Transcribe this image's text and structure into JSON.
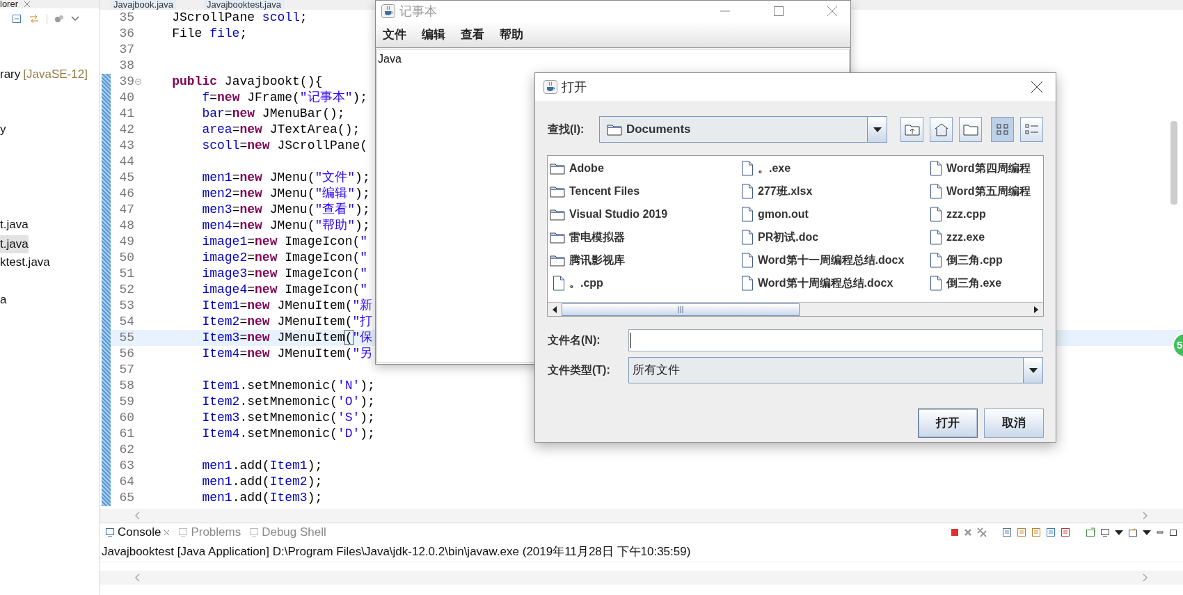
{
  "sidebar": {
    "title": "lorer",
    "items": [
      {
        "text": "rary",
        "decoration": "[JavaSE-12]",
        "selected": false
      },
      {
        "text": "y",
        "selected": false
      },
      {
        "text": "t.java",
        "selected": false
      },
      {
        "text": "t.java",
        "selected": true
      },
      {
        "text": "ktest.java",
        "selected": false
      },
      {
        "text": "a",
        "selected": false
      }
    ]
  },
  "editor": {
    "tabs": [
      "Javajbook.java",
      "Javajbooktest.java"
    ],
    "lines": [
      {
        "number": "35",
        "changed": false,
        "fold": false,
        "current": false,
        "tokens": [
          {
            "text": "    JScrollPane ",
            "kind": "plain"
          },
          {
            "text": "scoll",
            "kind": "field"
          },
          {
            "text": ";",
            "kind": "plain"
          }
        ]
      },
      {
        "number": "36",
        "changed": false,
        "fold": false,
        "current": false,
        "tokens": [
          {
            "text": "    File ",
            "kind": "plain"
          },
          {
            "text": "file",
            "kind": "field"
          },
          {
            "text": ";",
            "kind": "plain"
          }
        ]
      },
      {
        "number": "37",
        "changed": false,
        "fold": false,
        "current": false
      },
      {
        "number": "38",
        "changed": false,
        "fold": false,
        "current": false
      },
      {
        "number": "39",
        "changed": true,
        "fold": true,
        "current": false,
        "tokens": [
          {
            "text": "    public",
            "kind": "keyword"
          },
          {
            "text": " Javajbookt(){",
            "kind": "plain"
          }
        ]
      },
      {
        "number": "40",
        "changed": true,
        "fold": false,
        "current": false,
        "tokens": [
          {
            "text": "        f",
            "kind": "field"
          },
          {
            "text": "=",
            "kind": "plain"
          },
          {
            "text": "new",
            "kind": "keyword"
          },
          {
            "text": " JFrame(",
            "kind": "plain"
          },
          {
            "text": "\"记事本\"",
            "kind": "string"
          },
          {
            "text": ");",
            "kind": "plain"
          }
        ]
      },
      {
        "number": "41",
        "changed": true,
        "fold": false,
        "current": false,
        "tokens": [
          {
            "text": "        bar",
            "kind": "field"
          },
          {
            "text": "=",
            "kind": "plain"
          },
          {
            "text": "new",
            "kind": "keyword"
          },
          {
            "text": " JMenuBar();",
            "kind": "plain"
          }
        ]
      },
      {
        "number": "42",
        "changed": true,
        "fold": false,
        "current": false,
        "tokens": [
          {
            "text": "        area",
            "kind": "field"
          },
          {
            "text": "=",
            "kind": "plain"
          },
          {
            "text": "new",
            "kind": "keyword"
          },
          {
            "text": " JTextArea();",
            "kind": "plain"
          }
        ]
      },
      {
        "number": "43",
        "changed": true,
        "fold": false,
        "current": false,
        "tokens": [
          {
            "text": "        scoll",
            "kind": "field"
          },
          {
            "text": "=",
            "kind": "plain"
          },
          {
            "text": "new",
            "kind": "keyword"
          },
          {
            "text": " JScrollPane(",
            "kind": "plain"
          }
        ]
      },
      {
        "number": "44",
        "changed": true,
        "fold": false,
        "current": false
      },
      {
        "number": "45",
        "changed": true,
        "fold": false,
        "current": false,
        "tokens": [
          {
            "text": "        men1",
            "kind": "field"
          },
          {
            "text": "=",
            "kind": "plain"
          },
          {
            "text": "new",
            "kind": "keyword"
          },
          {
            "text": " JMenu(",
            "kind": "plain"
          },
          {
            "text": "\"文件\"",
            "kind": "string"
          },
          {
            "text": ");",
            "kind": "plain"
          }
        ]
      },
      {
        "number": "46",
        "changed": true,
        "fold": false,
        "current": false,
        "tokens": [
          {
            "text": "        men2",
            "kind": "field"
          },
          {
            "text": "=",
            "kind": "plain"
          },
          {
            "text": "new",
            "kind": "keyword"
          },
          {
            "text": " JMenu(",
            "kind": "plain"
          },
          {
            "text": "\"编辑\"",
            "kind": "string"
          },
          {
            "text": ");",
            "kind": "plain"
          }
        ]
      },
      {
        "number": "47",
        "changed": true,
        "fold": false,
        "current": false,
        "tokens": [
          {
            "text": "        men3",
            "kind": "field"
          },
          {
            "text": "=",
            "kind": "plain"
          },
          {
            "text": "new",
            "kind": "keyword"
          },
          {
            "text": " JMenu(",
            "kind": "plain"
          },
          {
            "text": "\"查看\"",
            "kind": "string"
          },
          {
            "text": ");",
            "kind": "plain"
          }
        ]
      },
      {
        "number": "48",
        "changed": true,
        "fold": false,
        "current": false,
        "tokens": [
          {
            "text": "        men4",
            "kind": "field"
          },
          {
            "text": "=",
            "kind": "plain"
          },
          {
            "text": "new",
            "kind": "keyword"
          },
          {
            "text": " JMenu(",
            "kind": "plain"
          },
          {
            "text": "\"帮助\"",
            "kind": "string"
          },
          {
            "text": ");",
            "kind": "plain"
          }
        ]
      },
      {
        "number": "49",
        "changed": true,
        "fold": false,
        "current": false,
        "tokens": [
          {
            "text": "        image1",
            "kind": "field"
          },
          {
            "text": "=",
            "kind": "plain"
          },
          {
            "text": "new",
            "kind": "keyword"
          },
          {
            "text": " ImageIcon(",
            "kind": "plain"
          },
          {
            "text": "\"",
            "kind": "string"
          }
        ]
      },
      {
        "number": "50",
        "changed": true,
        "fold": false,
        "current": false,
        "tokens": [
          {
            "text": "        image2",
            "kind": "field"
          },
          {
            "text": "=",
            "kind": "plain"
          },
          {
            "text": "new",
            "kind": "keyword"
          },
          {
            "text": " ImageIcon(",
            "kind": "plain"
          },
          {
            "text": "\"",
            "kind": "string"
          }
        ]
      },
      {
        "number": "51",
        "changed": true,
        "fold": false,
        "current": false,
        "tokens": [
          {
            "text": "        image3",
            "kind": "field"
          },
          {
            "text": "=",
            "kind": "plain"
          },
          {
            "text": "new",
            "kind": "keyword"
          },
          {
            "text": " ImageIcon(",
            "kind": "plain"
          },
          {
            "text": "\"",
            "kind": "string"
          }
        ]
      },
      {
        "number": "52",
        "changed": true,
        "fold": false,
        "current": false,
        "tokens": [
          {
            "text": "        image4",
            "kind": "field"
          },
          {
            "text": "=",
            "kind": "plain"
          },
          {
            "text": "new",
            "kind": "keyword"
          },
          {
            "text": " ImageIcon(",
            "kind": "plain"
          },
          {
            "text": "\"",
            "kind": "string"
          }
        ]
      },
      {
        "number": "53",
        "changed": true,
        "fold": false,
        "current": false,
        "tokens": [
          {
            "text": "        Item1",
            "kind": "field"
          },
          {
            "text": "=",
            "kind": "plain"
          },
          {
            "text": "new",
            "kind": "keyword"
          },
          {
            "text": " JMenuItem(",
            "kind": "plain"
          },
          {
            "text": "\"新",
            "kind": "string"
          }
        ]
      },
      {
        "number": "54",
        "changed": true,
        "fold": false,
        "current": false,
        "tokens": [
          {
            "text": "        Item2",
            "kind": "field"
          },
          {
            "text": "=",
            "kind": "plain"
          },
          {
            "text": "new",
            "kind": "keyword"
          },
          {
            "text": " JMenuItem(",
            "kind": "plain"
          },
          {
            "text": "\"打",
            "kind": "string"
          }
        ]
      },
      {
        "number": "55",
        "changed": true,
        "fold": false,
        "current": true,
        "tokens": [
          {
            "text": "        Item3",
            "kind": "field"
          },
          {
            "text": "=",
            "kind": "plain"
          },
          {
            "text": "new",
            "kind": "keyword"
          },
          {
            "text": " JMenuItem",
            "kind": "plain"
          },
          {
            "text": "(",
            "kind": "match"
          },
          {
            "text": "\"保",
            "kind": "string"
          }
        ]
      },
      {
        "number": "56",
        "changed": true,
        "fold": false,
        "current": false,
        "tokens": [
          {
            "text": "        Item4",
            "kind": "field"
          },
          {
            "text": "=",
            "kind": "plain"
          },
          {
            "text": "new",
            "kind": "keyword"
          },
          {
            "text": " JMenuItem(",
            "kind": "plain"
          },
          {
            "text": "\"另",
            "kind": "string"
          }
        ]
      },
      {
        "number": "57",
        "changed": true,
        "fold": false,
        "current": false
      },
      {
        "number": "58",
        "changed": true,
        "fold": false,
        "current": false,
        "tokens": [
          {
            "text": "        Item1",
            "kind": "field"
          },
          {
            "text": ".setMnemonic(",
            "kind": "plain"
          },
          {
            "text": "'N'",
            "kind": "string"
          },
          {
            "text": ");",
            "kind": "plain"
          }
        ]
      },
      {
        "number": "59",
        "changed": true,
        "fold": false,
        "current": false,
        "tokens": [
          {
            "text": "        Item2",
            "kind": "field"
          },
          {
            "text": ".setMnemonic(",
            "kind": "plain"
          },
          {
            "text": "'O'",
            "kind": "string"
          },
          {
            "text": ");",
            "kind": "plain"
          }
        ]
      },
      {
        "number": "60",
        "changed": true,
        "fold": false,
        "current": false,
        "tokens": [
          {
            "text": "        Item3",
            "kind": "field"
          },
          {
            "text": ".setMnemonic(",
            "kind": "plain"
          },
          {
            "text": "'S'",
            "kind": "string"
          },
          {
            "text": ");",
            "kind": "plain"
          }
        ]
      },
      {
        "number": "61",
        "changed": true,
        "fold": false,
        "current": false,
        "tokens": [
          {
            "text": "        Item4",
            "kind": "field"
          },
          {
            "text": ".setMnemonic(",
            "kind": "plain"
          },
          {
            "text": "'D'",
            "kind": "string"
          },
          {
            "text": ");",
            "kind": "plain"
          }
        ]
      },
      {
        "number": "62",
        "changed": true,
        "fold": false,
        "current": false
      },
      {
        "number": "63",
        "changed": true,
        "fold": false,
        "current": false,
        "tokens": [
          {
            "text": "        men1",
            "kind": "field"
          },
          {
            "text": ".add(",
            "kind": "plain"
          },
          {
            "text": "Item1",
            "kind": "field"
          },
          {
            "text": ");",
            "kind": "plain"
          }
        ]
      },
      {
        "number": "64",
        "changed": true,
        "fold": false,
        "current": false,
        "tokens": [
          {
            "text": "        men1",
            "kind": "field"
          },
          {
            "text": ".add(",
            "kind": "plain"
          },
          {
            "text": "Item2",
            "kind": "field"
          },
          {
            "text": ");",
            "kind": "plain"
          }
        ]
      },
      {
        "number": "65",
        "changed": true,
        "fold": false,
        "current": false,
        "tokens": [
          {
            "text": "        men1",
            "kind": "field"
          },
          {
            "text": ".add(",
            "kind": "plain"
          },
          {
            "text": "Item3",
            "kind": "field"
          },
          {
            "text": ");",
            "kind": "plain"
          }
        ]
      }
    ]
  },
  "console": {
    "tabs": [
      {
        "label": "Console",
        "selected": true
      },
      {
        "label": "Problems",
        "selected": false
      },
      {
        "label": "Debug Shell",
        "selected": false
      }
    ],
    "text": "Javajbooktest [Java Application] D:\\Program Files\\Java\\jdk-12.0.2\\bin\\javaw.exe (2019年11月28日 下午10:35:59)"
  },
  "badge": "5",
  "notepad": {
    "title": "记事本",
    "menus": [
      "文件",
      "编辑",
      "查看",
      "帮助"
    ],
    "content": "Java"
  },
  "dialog": {
    "title": "打开",
    "look_in": {
      "label": "查找(I):",
      "value": "Documents"
    },
    "tool_buttons": [
      {
        "kind": "up",
        "selected": false
      },
      {
        "kind": "home",
        "selected": false
      },
      {
        "kind": "new-folder",
        "selected": false
      },
      {
        "kind": "list",
        "selected": true
      },
      {
        "kind": "details",
        "selected": false
      }
    ],
    "files": [
      {
        "name": "Adobe",
        "kind": "folder"
      },
      {
        "name": "Tencent Files",
        "kind": "folder"
      },
      {
        "name": "Visual Studio 2019",
        "kind": "folder"
      },
      {
        "name": "雷电模拟器",
        "kind": "folder"
      },
      {
        "name": "腾讯影视库",
        "kind": "folder"
      },
      {
        "name": "。.cpp",
        "kind": "file"
      },
      {
        "name": "。.exe",
        "kind": "file"
      },
      {
        "name": "277班.xlsx",
        "kind": "file"
      },
      {
        "name": "gmon.out",
        "kind": "file"
      },
      {
        "name": "PR初试.doc",
        "kind": "file"
      },
      {
        "name": "Word第十一周编程总结.docx",
        "kind": "file"
      },
      {
        "name": "Word第十周编程总结.docx",
        "kind": "file"
      },
      {
        "name": "Word第四周编程",
        "kind": "file"
      },
      {
        "name": "Word第五周编程",
        "kind": "file"
      },
      {
        "name": "zzz.cpp",
        "kind": "file"
      },
      {
        "name": "zzz.exe",
        "kind": "file"
      },
      {
        "name": "倒三角.cpp",
        "kind": "file"
      },
      {
        "name": "倒三角.exe",
        "kind": "file"
      }
    ],
    "file_name": {
      "label": "文件名(N):"
    },
    "file_type": {
      "label": "文件类型(T):",
      "value": "所有文件"
    },
    "buttons": [
      "打开",
      "取消"
    ]
  }
}
